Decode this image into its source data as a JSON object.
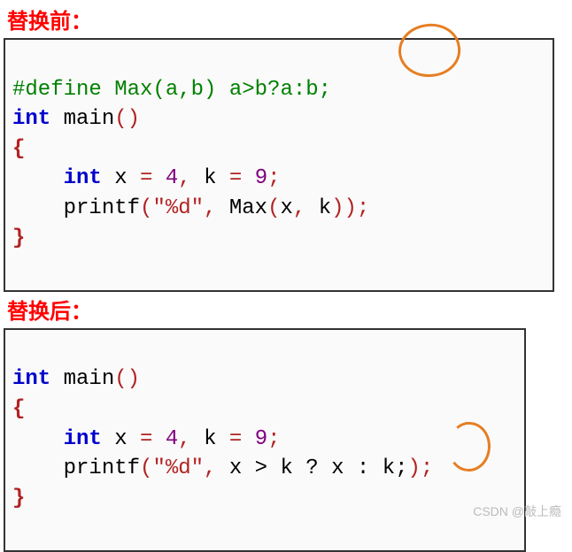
{
  "headings": {
    "before": "替换前：",
    "after": "替换后："
  },
  "code_before": {
    "line1": {
      "define": "#define ",
      "rest": "Max(a,b) a>b?a:b;"
    },
    "line2": {
      "kw": "int ",
      "name": "main",
      "p": "()"
    },
    "line3": "{",
    "line4": {
      "indent": "    ",
      "kw": "int ",
      "t": "x ",
      "eq": "= ",
      "n1": "4",
      "c1": ", ",
      "t2": "k ",
      "eq2": "= ",
      "n2": "9",
      "sc": ";"
    },
    "line5": {
      "indent": "    ",
      "fn": "printf",
      "p1": "(",
      "str": "\"%d\"",
      "c": ", ",
      "call": "Max",
      "p2": "(",
      "a": "x",
      "cm": ", ",
      "b": "k",
      "p3": "))",
      "sc": ";"
    },
    "line6": "}"
  },
  "code_after": {
    "line2": {
      "kw": "int ",
      "name": "main",
      "p": "()"
    },
    "line3": "{",
    "line4": {
      "indent": "    ",
      "kw": "int ",
      "t": "x ",
      "eq": "= ",
      "n1": "4",
      "c1": ", ",
      "t2": "k ",
      "eq2": "= ",
      "n2": "9",
      "sc": ";"
    },
    "line5": {
      "indent": "    ",
      "fn": "printf",
      "p1": "(",
      "str": "\"%d\"",
      "c": ", ",
      "expr": "x > k ? x : k;",
      "p3": ")",
      "sc": ";"
    },
    "line6": "}"
  },
  "watermark": "CSDN @敲上瘾"
}
